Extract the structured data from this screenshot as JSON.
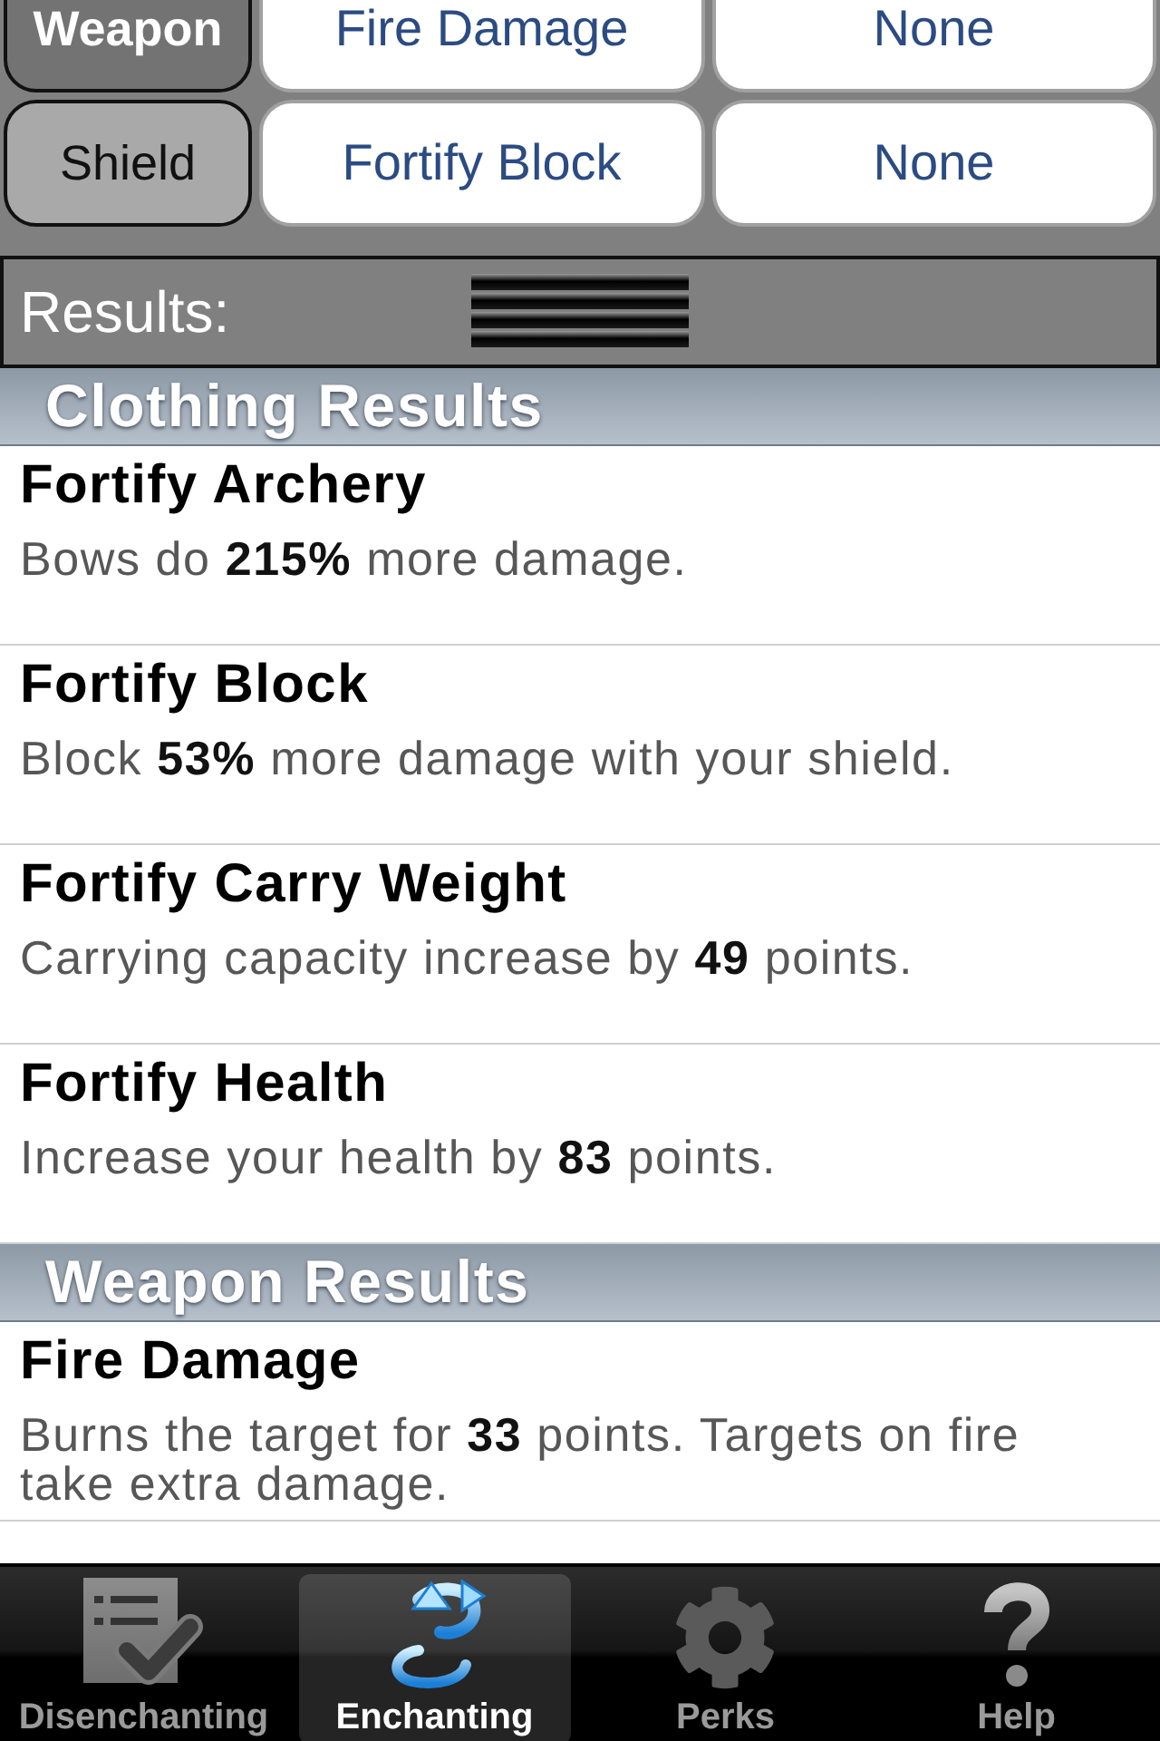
{
  "slots": [
    {
      "label": "Weapon",
      "selected": true,
      "enchantments": [
        "Fire Damage",
        "None"
      ]
    },
    {
      "label": "Shield",
      "selected": false,
      "enchantments": [
        "Fortify Block",
        "None"
      ]
    }
  ],
  "results_bar": {
    "label": "Results:"
  },
  "sections": [
    {
      "title": "Clothing Results",
      "items": [
        {
          "name": "Fortify Archery",
          "description": "Bows do **215%** more damage."
        },
        {
          "name": "Fortify Block",
          "description": "Block **53%** more damage with your shield."
        },
        {
          "name": "Fortify Carry Weight",
          "description": "Carrying capacity increase by **49** points."
        },
        {
          "name": "Fortify Health",
          "description": "Increase your health by **83** points."
        }
      ]
    },
    {
      "title": "Weapon Results",
      "items": [
        {
          "name": "Fire Damage",
          "description": "Burns the target for **33** points. Targets on fire take extra damage."
        }
      ]
    }
  ],
  "tab_bar": {
    "tabs": [
      {
        "label": "Disenchanting",
        "selected": false
      },
      {
        "label": "Enchanting",
        "selected": true
      },
      {
        "label": "Perks",
        "selected": false
      },
      {
        "label": "Help",
        "selected": false
      }
    ]
  }
}
